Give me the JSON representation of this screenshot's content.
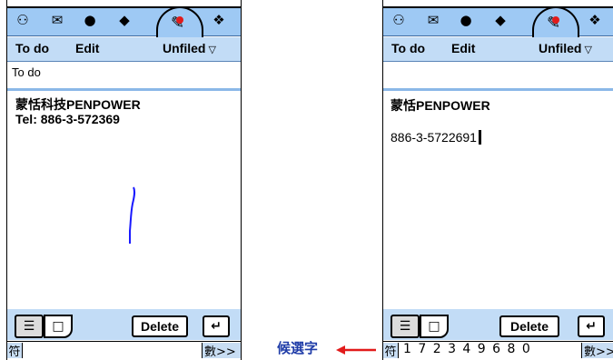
{
  "left_device": {
    "menu": {
      "todo": "To do",
      "edit": "Edit",
      "category": "Unfiled"
    },
    "field_label": "To do",
    "note_line1": "蒙恬科技PENPOWER",
    "note_line2": "Tel: 886-3-572369",
    "toolbar": {
      "delete_label": "Delete"
    },
    "candidate": {
      "left_label": "符",
      "right_label": "數>>"
    }
  },
  "right_device": {
    "menu": {
      "todo": "To do",
      "edit": "Edit",
      "category": "Unfiled"
    },
    "note_line1": "蒙恬PENPOWER",
    "note_line2": "886-3-5722691",
    "toolbar": {
      "delete_label": "Delete"
    },
    "candidate": {
      "left_label": "符",
      "digits": "1 7 2 3 4 9 6 8 0",
      "right_label": "數>>"
    }
  },
  "annotation": {
    "label": "候選字",
    "arrow_color": "#e21b1b"
  },
  "colors": {
    "title_bar": "#9ec9f4",
    "menu_bar": "#c2dcf6",
    "ink": "#1a1aff"
  },
  "icons": [
    "address-book-icon",
    "mail-icon",
    "globe-icon",
    "tag-icon",
    "pen-icon",
    "apps-icon"
  ]
}
